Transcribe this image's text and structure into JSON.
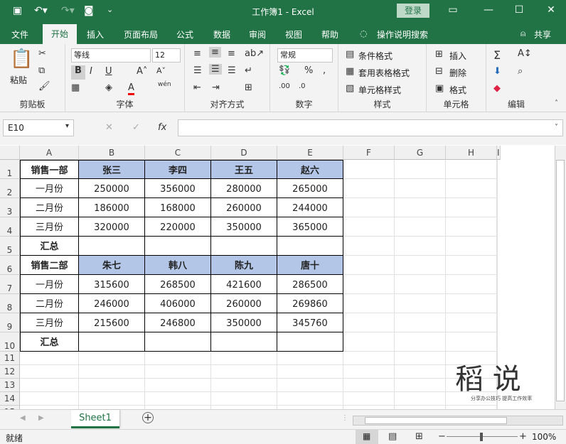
{
  "titlebar": {
    "title": "工作簿1  -  Excel",
    "login": "登录"
  },
  "menu": {
    "items": [
      "文件",
      "开始",
      "插入",
      "页面布局",
      "公式",
      "数据",
      "审阅",
      "视图",
      "帮助"
    ],
    "tell_me": "操作说明搜索",
    "share": "共享"
  },
  "ribbon": {
    "clipboard": {
      "paste": "粘贴",
      "label": "剪贴板"
    },
    "font": {
      "name": "等线",
      "size": "12",
      "label": "字体",
      "bold": "B",
      "italic": "I",
      "underline": "U",
      "phonetic": "wén"
    },
    "alignment": {
      "label": "对齐方式"
    },
    "number": {
      "format": "常规",
      "label": "数字"
    },
    "styles": {
      "cond": "条件格式",
      "table": "套用表格格式",
      "cell": "单元格样式",
      "label": "样式"
    },
    "cells": {
      "insert": "插入",
      "delete": "删除",
      "format": "格式",
      "label": "单元格"
    },
    "editing": {
      "label": "编辑"
    }
  },
  "formula": {
    "cell_ref": "E10",
    "fx": "fx",
    "content": ""
  },
  "columns": [
    "A",
    "B",
    "C",
    "D",
    "E",
    "F",
    "G",
    "H",
    "I"
  ],
  "rows": [
    "1",
    "2",
    "3",
    "4",
    "5",
    "6",
    "7",
    "8",
    "9",
    "10",
    "11",
    "12",
    "13",
    "14",
    "15"
  ],
  "table": [
    [
      "销售一部",
      "张三",
      "李四",
      "王五",
      "赵六"
    ],
    [
      "一月份",
      "250000",
      "356000",
      "280000",
      "265000"
    ],
    [
      "二月份",
      "186000",
      "168000",
      "260000",
      "244000"
    ],
    [
      "三月份",
      "320000",
      "220000",
      "350000",
      "365000"
    ],
    [
      "汇总",
      "",
      "",
      "",
      ""
    ],
    [
      "销售二部",
      "朱七",
      "韩八",
      "陈九",
      "唐十"
    ],
    [
      "一月份",
      "315600",
      "268500",
      "421600",
      "286500"
    ],
    [
      "二月份",
      "246000",
      "406000",
      "260000",
      "269860"
    ],
    [
      "三月份",
      "215600",
      "246800",
      "350000",
      "345760"
    ],
    [
      "汇总",
      "",
      "",
      "",
      ""
    ]
  ],
  "logo": {
    "text": "稻  说",
    "sub": "分享办公技巧  提高工作效率"
  },
  "sheet": {
    "tab": "Sheet1",
    "add": "+"
  },
  "status": {
    "ready": "就绪",
    "zoom": "100%"
  },
  "colors": {
    "accent": "#217346",
    "header_fill": "#b4c6e7"
  }
}
